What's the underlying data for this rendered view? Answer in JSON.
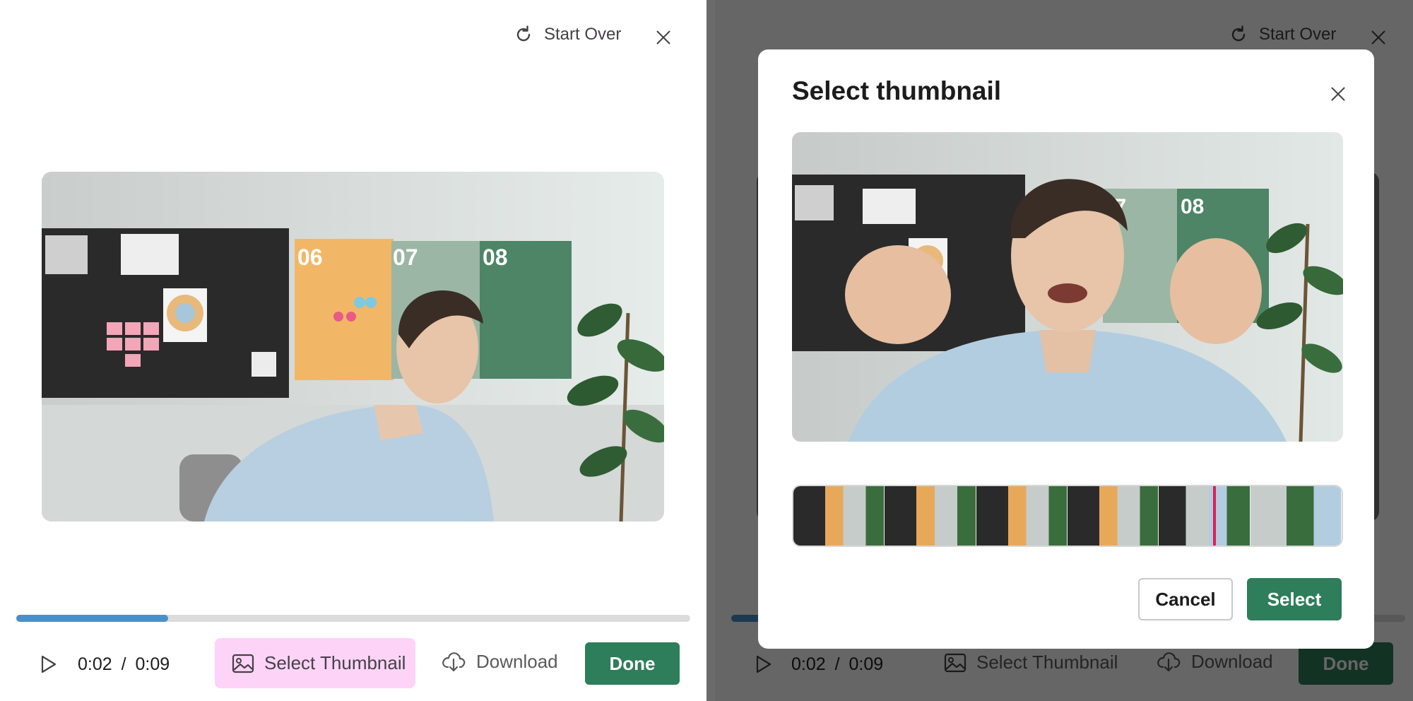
{
  "editor": {
    "start_over_label": "Start Over",
    "time_current": "0:02",
    "time_separator": "/",
    "time_total": "0:09",
    "select_thumbnail_label": "Select Thumbnail",
    "download_label": "Download",
    "done_label": "Done",
    "progress_fraction": 0.225
  },
  "modal": {
    "title": "Select thumbnail",
    "cancel_label": "Cancel",
    "select_label": "Select",
    "filmstrip_frames": 6
  },
  "colors": {
    "accent_green": "#2e7d5b",
    "progress_blue": "#4a90c8",
    "highlight_pink": "#fdd3f8",
    "marker_red": "#e01e5a"
  },
  "icons": [
    "refresh-icon",
    "close-icon",
    "play-icon",
    "image-icon",
    "cloud-download-icon"
  ]
}
